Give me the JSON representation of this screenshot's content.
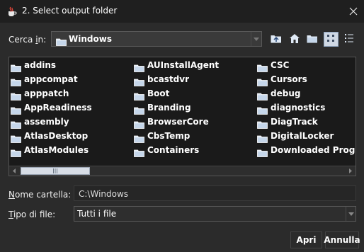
{
  "window": {
    "title": "2. Select output folder",
    "app_icon": "java-cup-icon",
    "close_icon": "close-icon"
  },
  "look_in": {
    "label_prefix": "Cerca ",
    "label_mnemonic": "i",
    "label_suffix": "n:",
    "value": "Windows"
  },
  "toolbar": {
    "buttons": [
      "up-one-level-icon",
      "home-icon",
      "new-folder-icon",
      "list-view-icon",
      "details-view-icon"
    ],
    "active_view": "list-view-icon"
  },
  "files": {
    "columns": [
      [
        "addins",
        "appcompat",
        "apppatch",
        "AppReadiness",
        "assembly",
        "AtlasDesktop",
        "AtlasModules"
      ],
      [
        "AUInstallAgent",
        "bcastdvr",
        "Boot",
        "Branding",
        "BrowserCore",
        "CbsTemp",
        "Containers"
      ],
      [
        "CSC",
        "Cursors",
        "debug",
        "diagnostics",
        "DiagTrack",
        "DigitalLocker",
        "Downloaded Program Files"
      ]
    ],
    "item_icon": "folder-icon"
  },
  "folder_name": {
    "label_mnemonic": "N",
    "label_rest": "ome cartella:",
    "value": "C:\\Windows"
  },
  "file_type": {
    "label_mnemonic": "T",
    "label_rest": "ipo di file:",
    "value": "Tutti i file"
  },
  "buttons": {
    "open": "Apri",
    "cancel": "Annulla"
  },
  "colors": {
    "title_bar": "#1f1f1f",
    "dialog_bg": "#2b2b2b",
    "list_bg": "#1a1a1a",
    "folder_icon": "#dfe9f5",
    "active_toggle": "#cfd8e4"
  }
}
